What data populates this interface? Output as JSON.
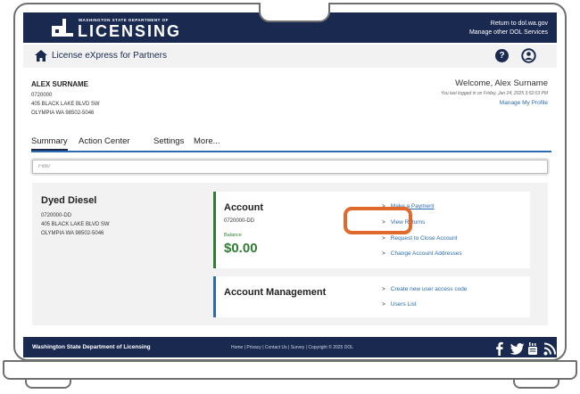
{
  "header": {
    "logo_small": "WASHINGTON STATE DEPARTMENT OF",
    "logo_big": "LICENSING",
    "link1": "Return to dol.wa.gov",
    "link2": "Manage other DOL Services"
  },
  "appbar": {
    "title": "License eXpress for Partners",
    "help_icon_text": "?"
  },
  "customer": {
    "name": "ALEX SURNAME",
    "id": "0720000",
    "address1": "405 BLACK LAKE BLVD SW",
    "address2": "OLYMPIA WA 98502-5046"
  },
  "welcome": {
    "title": "Welcome, Alex Surname",
    "last_login": "You last logged in on Friday, Jan 24, 2025 3:52:03 PM",
    "manage_profile": "Manage My Profile"
  },
  "tabs": [
    "Summary",
    "Action Center",
    "Settings",
    "More..."
  ],
  "filter": {
    "placeholder": "Filter",
    "value": ""
  },
  "account_item": {
    "name": "Dyed Diesel",
    "id": "0720000-DD",
    "address1": "405 BLACK LAKE BLVD SW",
    "address2": "OLYMPIA WA 98502-5046"
  },
  "account_card": {
    "title": "Account",
    "id": "0720000-DD",
    "balance_label": "Balance",
    "balance": "$0.00",
    "actions": [
      "Make a Payment",
      "View Returns",
      "Request to Close Account",
      "Change Account Addresses"
    ]
  },
  "management_card": {
    "title": "Account Management",
    "actions": [
      "Create new user access code",
      "Users List"
    ]
  },
  "footer": {
    "org": "Washington State Department of Licensing",
    "links": "Home | Privacy | Contact Us | Survey | Copyright © 2025 DOL",
    "social_icons": [
      "facebook-icon",
      "twitter-icon",
      "youtube-icon",
      "rss-icon"
    ]
  },
  "colors": {
    "navy": "#19294f",
    "link_blue": "#2b6cb0",
    "balance_green": "#2e7d32",
    "highlight_orange": "#e06a2c"
  },
  "chevron": ">"
}
